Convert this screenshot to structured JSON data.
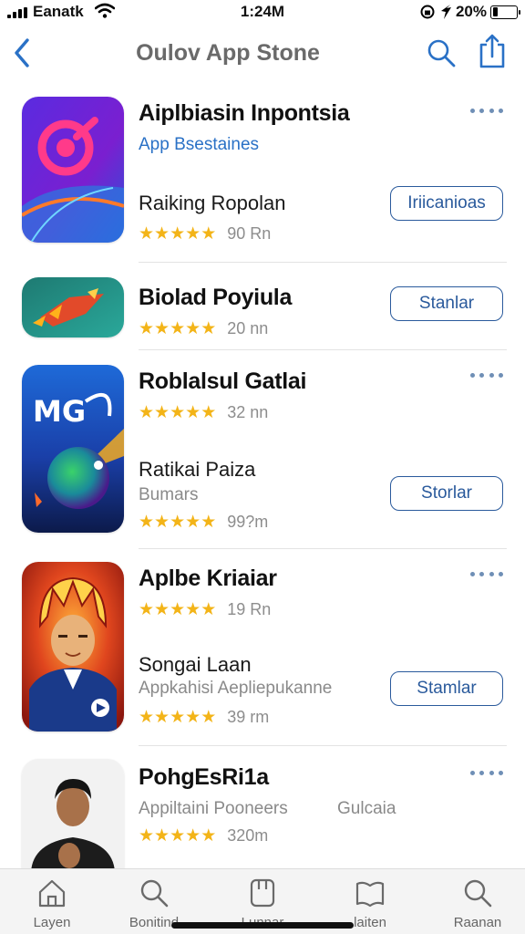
{
  "status_bar": {
    "carrier": "Eanatk",
    "time": "1:24M",
    "battery": "20%",
    "battery_level": 0.2,
    "icons": [
      "signal-icon",
      "wifi-icon",
      "lock-rotation-icon",
      "location-icon",
      "battery-icon"
    ]
  },
  "nav": {
    "title": "Oulov App Stone",
    "icons": [
      "back-chevron-icon",
      "search-icon",
      "share-icon"
    ]
  },
  "apps": [
    {
      "name": "Aiplbiasin Inpontsia",
      "subtitle": "App Bsestaines",
      "label": "Raiking Ropolan",
      "stars": 4.5,
      "count": "90 Rn",
      "button": "Iriicanioas"
    },
    {
      "name": "Biolad Poyiula",
      "stars": 4.5,
      "count": "20 nn",
      "button": "Stanlar"
    },
    {
      "name": "Roblalsul Gatlai",
      "stars": 4.5,
      "count": "32 nn",
      "label": "Ratikai Paiza",
      "subtitle": "Bumars",
      "stars2": 4.5,
      "count2": "99?m",
      "button": "Storlar"
    },
    {
      "name": "Aplbe Kriaiar",
      "stars": 4.5,
      "count": "19 Rn",
      "label": "Songai Laan",
      "subtitle": "Appkahisi Aepliepukanne",
      "stars2": 4.5,
      "count2": "39 rm",
      "button": "Stamlar"
    },
    {
      "name": "PohgEsRi1a",
      "subtitle": "Appiltaini Pooneers",
      "subtitle_extra": "Gulcaia",
      "stars": 4.5,
      "count": "320m"
    }
  ],
  "colors": {
    "accent": "#2a5a9c",
    "link": "#2a71c6",
    "star": "#f3b418"
  },
  "tabs": [
    {
      "label": "Layen",
      "icon": "home-icon"
    },
    {
      "label": "Bonitind",
      "icon": "search-icon"
    },
    {
      "label": "Lunnar",
      "icon": "apps-icon"
    },
    {
      "label": "laiten",
      "icon": "book-icon"
    },
    {
      "label": "Raanan",
      "icon": "search-icon"
    }
  ]
}
